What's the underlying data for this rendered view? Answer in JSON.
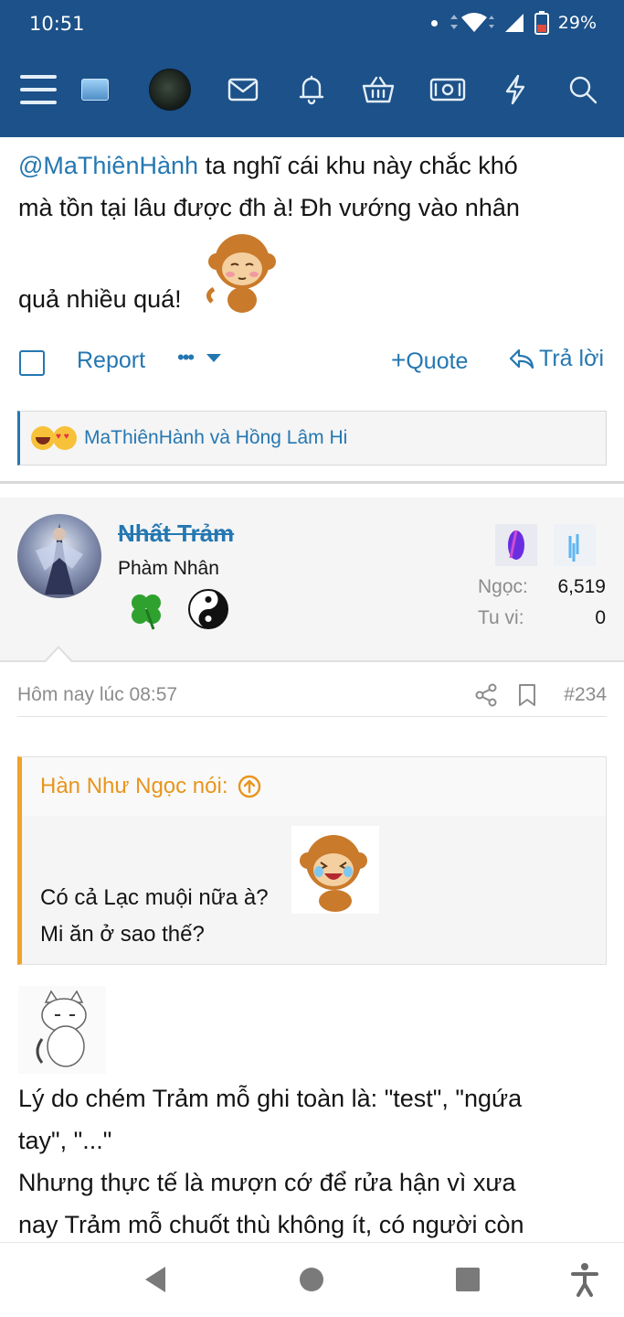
{
  "status_bar": {
    "time": "10:51",
    "battery": "29%"
  },
  "nav": {
    "icons": [
      "menu-icon",
      "logo-icon",
      "user-avatar",
      "mail-icon",
      "bell-icon",
      "basket-icon",
      "money-icon",
      "bolt-icon",
      "search-icon"
    ]
  },
  "post1": {
    "mention": "@MaThiênHành",
    "line1": " ta nghĩ cái khu này chắc khó",
    "line2": "mà tồn tại lâu được đh à! Đh vướng vào nhân",
    "line3": "quả nhiều quá!",
    "report_label": "Report",
    "more_label": "•••",
    "quote_label": "Quote",
    "reply_label": "Trả lời",
    "reactions_text": "MaThiênHành và Hồng Lâm Hi"
  },
  "post2": {
    "username": "Nhất Trảm",
    "user_title": "Phàm Nhân",
    "stats": [
      {
        "label": "Ngọc:",
        "value": "6,519"
      },
      {
        "label": "Tu vi:",
        "value": "0"
      }
    ],
    "timestamp": "Hôm nay lúc 08:57",
    "post_number": "#234",
    "quote": {
      "author": "Hàn Như Ngọc nói:",
      "line1": "Có cả Lạc muội nữa à?",
      "line2": "Mi ăn ở sao thế?"
    },
    "body": {
      "line1": "Lý do chém Trảm mỗ ghi toàn là: \"test\", \"ngứa",
      "line2": "tay\", \"...\"",
      "line3": "Nhưng thực tế là mượn cớ để rửa hận vì xưa",
      "line4": "nay Trảm mỗ chuốt thù không ít, có người còn"
    }
  },
  "colors": {
    "header": "#1c5189",
    "link": "#2577b1",
    "quote_accent": "#f0a22a"
  }
}
